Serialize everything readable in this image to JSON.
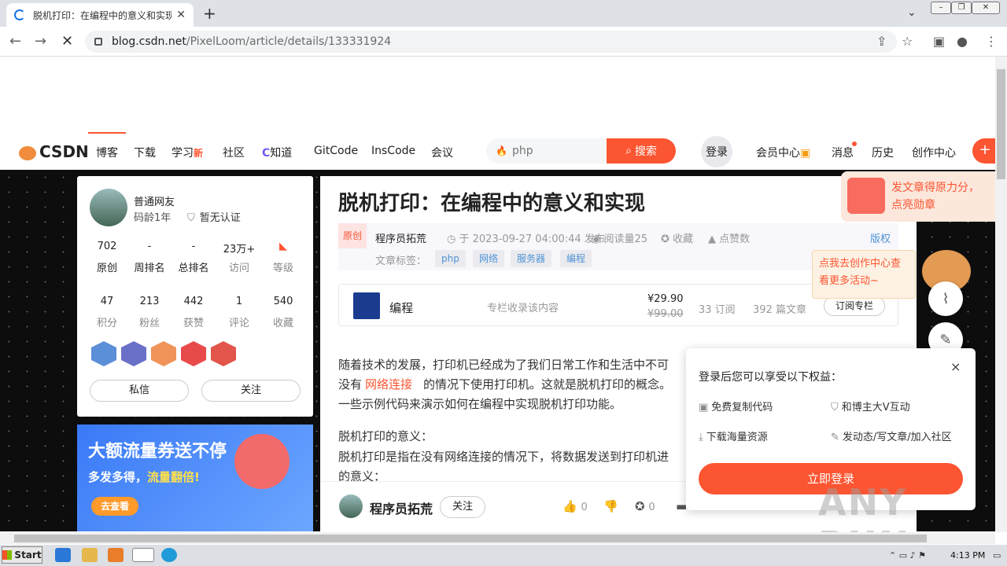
{
  "browser": {
    "tab_title": "脱机打印：在编程中的意义和实现-C",
    "tab_close": "✕",
    "new_tab": "+",
    "url_host": "blog.csdn.net",
    "url_path": "/PixelLoom/article/details/133331924",
    "back": "←",
    "forward": "→",
    "reload": "✕"
  },
  "csdn_nav": {
    "logo": "CSDN",
    "items": [
      "博客",
      "下载",
      "学习",
      "社区",
      "知道",
      "GitCode",
      "InsCode",
      "会议"
    ],
    "learn_badge": "新",
    "search_placeholder": "php",
    "search_button": "搜索",
    "login": "登录",
    "right_items": [
      "会员中心",
      "消息",
      "历史",
      "创作中心"
    ],
    "plus": "+"
  },
  "profile": {
    "name": "普通网友",
    "age": "码龄1年",
    "cert": "暂无认证",
    "stats_row1": [
      {
        "value": "702",
        "label": "原创"
      },
      {
        "value": "-",
        "label": "周排名"
      },
      {
        "value": "-",
        "label": "总排名"
      },
      {
        "value": "23万+",
        "label": "访问"
      },
      {
        "value": "",
        "label": "等级"
      }
    ],
    "stats_row2": [
      {
        "value": "47",
        "label": "积分"
      },
      {
        "value": "213",
        "label": "粉丝"
      },
      {
        "value": "442",
        "label": "获赞"
      },
      {
        "value": "1",
        "label": "评论"
      },
      {
        "value": "540",
        "label": "收藏"
      }
    ],
    "message_button": "私信",
    "follow_button": "关注"
  },
  "ad": {
    "line1": "大额流量券送不停",
    "line2a": "多发多得，",
    "line2b": "流量翻倍!",
    "button": "去查看"
  },
  "article": {
    "title": "脱机打印：在编程中的意义和实现",
    "original": "原创",
    "author": "程序员拓荒",
    "date": "于 2023-09-27 04:00:44 发布",
    "reads": "阅读量25",
    "collect": "收藏",
    "likes": "点赞数",
    "copyright": "版权",
    "tags_label": "文章标签：",
    "tags": [
      "php",
      "网络",
      "服务器",
      "编程"
    ],
    "column": {
      "name": "编程",
      "included": "专栏收录该内容",
      "price": "¥29.90",
      "old_price": "¥99.00",
      "subs": "33 订阅",
      "articles": "392 篇文章",
      "subscribe": "订阅专栏"
    },
    "para1_line1": "随着技术的发展，打印机已经成为了我们日常工作和生活中不可",
    "para1_line2a": "没有",
    "para1_link": "网络连接",
    "para1_line2b": "的情况下使用打印机。这就是脱机打印的概念。",
    "para1_line3": "一些示例代码来演示如何在编程中实现脱机打印功能。",
    "para2_line1": "脱机打印的意义：",
    "para2_line2": "脱机打印是指在没有网络连接的情况下，将数据发送到打印机进",
    "para2_line3": "的意义："
  },
  "action_bar": {
    "author": "程序员拓荒",
    "follow": "关注",
    "like_count": "0",
    "star_count": "0"
  },
  "promo": {
    "line1": "发文章得原力分，",
    "line2": "点亮勋章"
  },
  "creator_popup": {
    "line1": "点我去创作中心查",
    "line2": "看更多活动~"
  },
  "login_popup": {
    "title": "登录后您可以享受以下权益：",
    "close": "×",
    "perks": [
      "免费复制代码",
      "和博主大V互动",
      "下载海量资源",
      "发动态/写文章/加入社区"
    ],
    "button": "立即登录"
  },
  "watermark": "ANY RUN",
  "taskbar": {
    "start": "Start",
    "clock": "4:13 PM"
  },
  "colors": {
    "accent": "#fc5531",
    "link": "#5094d5"
  }
}
